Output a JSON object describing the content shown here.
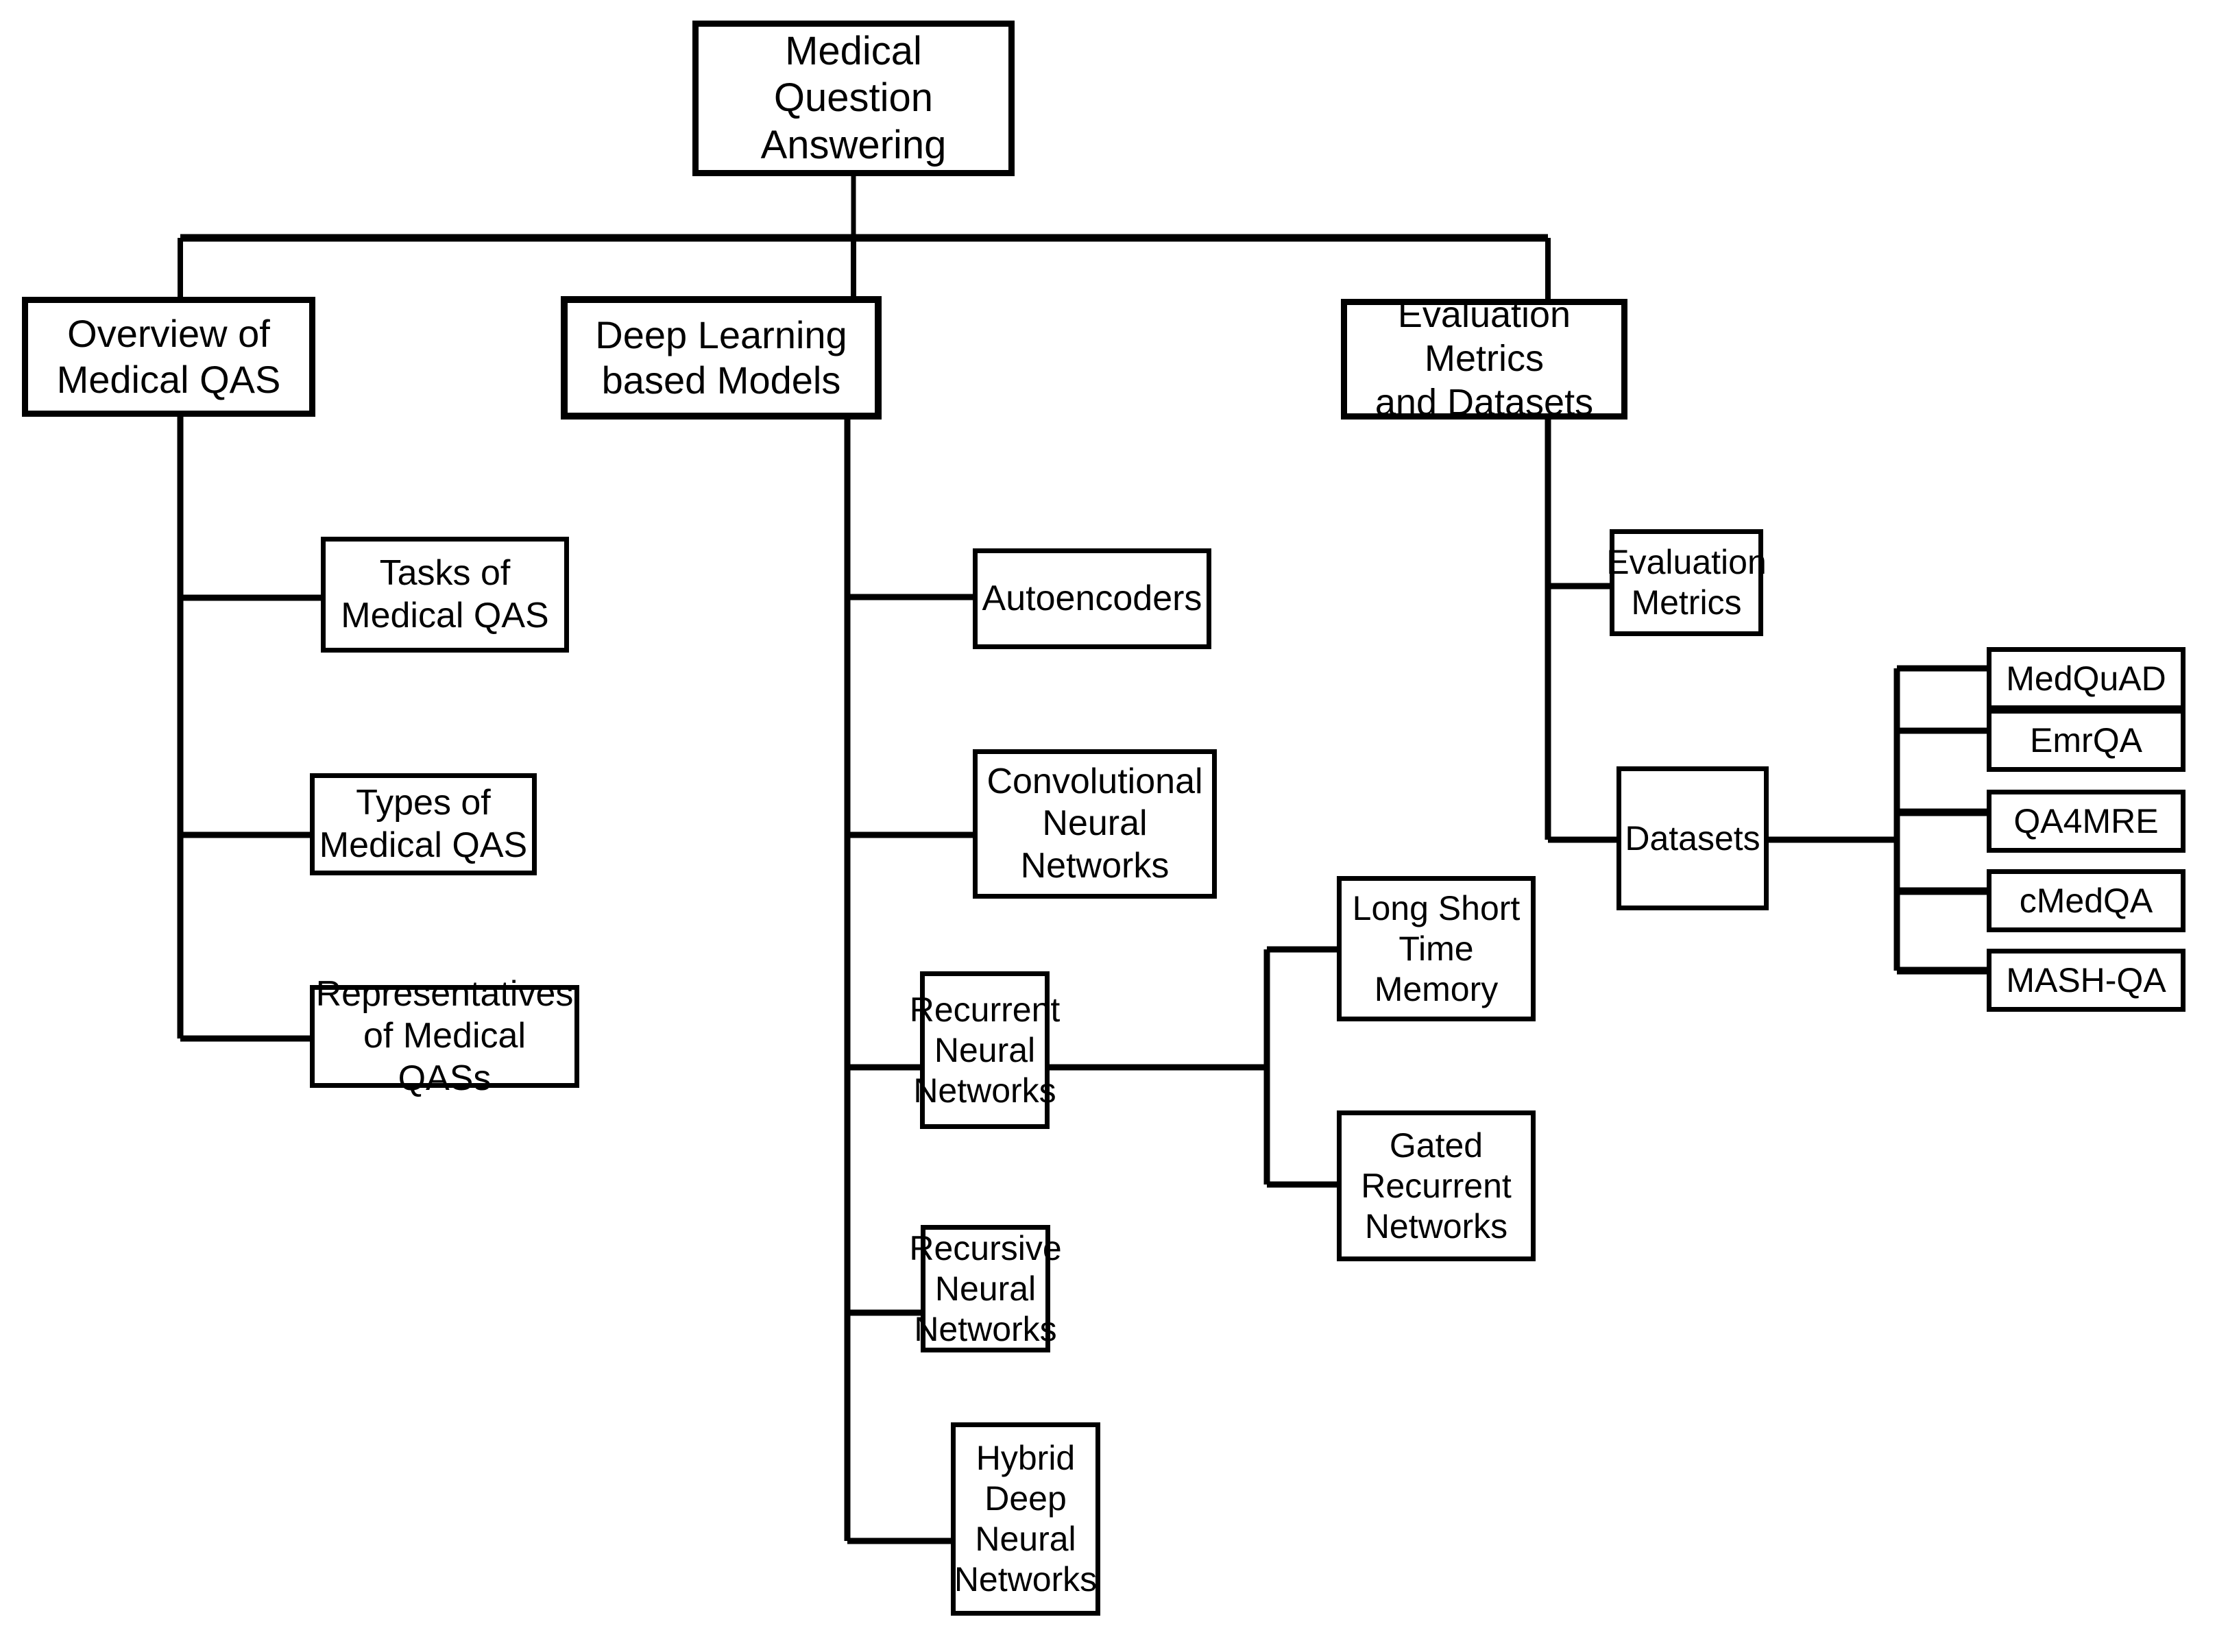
{
  "diagram": {
    "title": "Medical Question Answering taxonomy tree",
    "colors": {
      "line": "#000000",
      "box_border": "#000000",
      "box_fill": "#ffffff",
      "text": "#000000"
    }
  },
  "nodes": {
    "root": {
      "label": "Medical Question\nAnswering"
    },
    "l1": [
      {
        "label": "Overview of\nMedical QAS"
      },
      {
        "label": "Deep Learning based Models"
      },
      {
        "label": "Evaluation Metrics\nand Datasets"
      }
    ],
    "overview_children": [
      {
        "label": "Tasks of\nMedical QAS"
      },
      {
        "label": "Types of\nMedical QAS"
      },
      {
        "label": "Representatives\nof Medical QASs"
      }
    ],
    "deeplearning_children": [
      {
        "label": "Autoencoders"
      },
      {
        "label": "Convolutional\nNeural\nNetworks"
      },
      {
        "label": "Recurrent\nNeural\nNetworks"
      },
      {
        "label": "Recursive\nNeural\nNetworks"
      },
      {
        "label": "Hybrid Deep\nNeural\nNetworks"
      }
    ],
    "rnn_children": [
      {
        "label": "Long Short\nTime\nMemory"
      },
      {
        "label": "Gated\nRecurrent\nNetworks"
      }
    ],
    "evaluation_children": [
      {
        "label": "Evaluation\nMetrics"
      },
      {
        "label": "Datasets"
      }
    ],
    "dataset_children": [
      {
        "label": "MedQuAD"
      },
      {
        "label": "EmrQA"
      },
      {
        "label": "QA4MRE"
      },
      {
        "label": "cMedQA"
      },
      {
        "label": "MASH-QA"
      }
    ]
  }
}
